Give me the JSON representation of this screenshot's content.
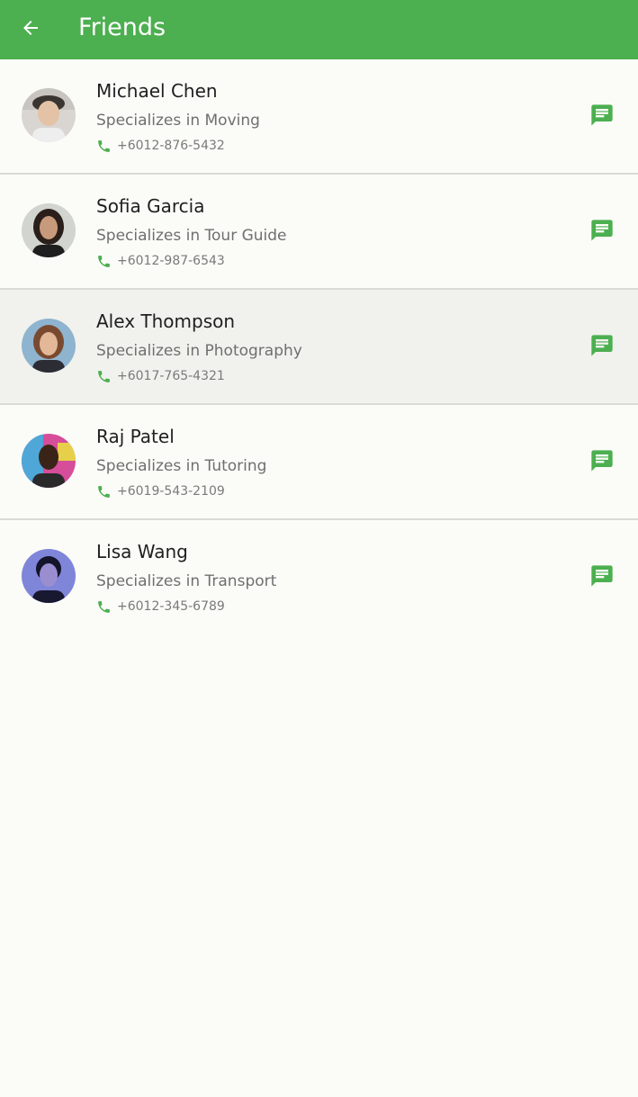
{
  "appbar": {
    "title": "Friends",
    "back_icon": "arrow-back-icon",
    "color": "#4caf50"
  },
  "friends": [
    {
      "name": "Michael Chen",
      "specialty": "Specializes in Moving",
      "phone": "+6012-876-5432",
      "avatar_icon": "avatar-photo",
      "selected": false
    },
    {
      "name": "Sofia Garcia",
      "specialty": "Specializes in Tour Guide",
      "phone": "+6012-987-6543",
      "avatar_icon": "avatar-photo",
      "selected": false
    },
    {
      "name": "Alex Thompson",
      "specialty": "Specializes in Photography",
      "phone": "+6017-765-4321",
      "avatar_icon": "avatar-photo",
      "selected": true
    },
    {
      "name": "Raj Patel",
      "specialty": "Specializes in Tutoring",
      "phone": "+6019-543-2109",
      "avatar_icon": "avatar-photo",
      "selected": false
    },
    {
      "name": "Lisa Wang",
      "specialty": "Specializes in Transport",
      "phone": "+6012-345-6789",
      "avatar_icon": "avatar-photo",
      "selected": false
    }
  ],
  "icons": {
    "phone": "phone-icon",
    "chat": "chat-message-icon"
  },
  "colors": {
    "accent": "#4caf50",
    "background": "#fbfcf7",
    "selected_row": "#f1f2ed"
  }
}
